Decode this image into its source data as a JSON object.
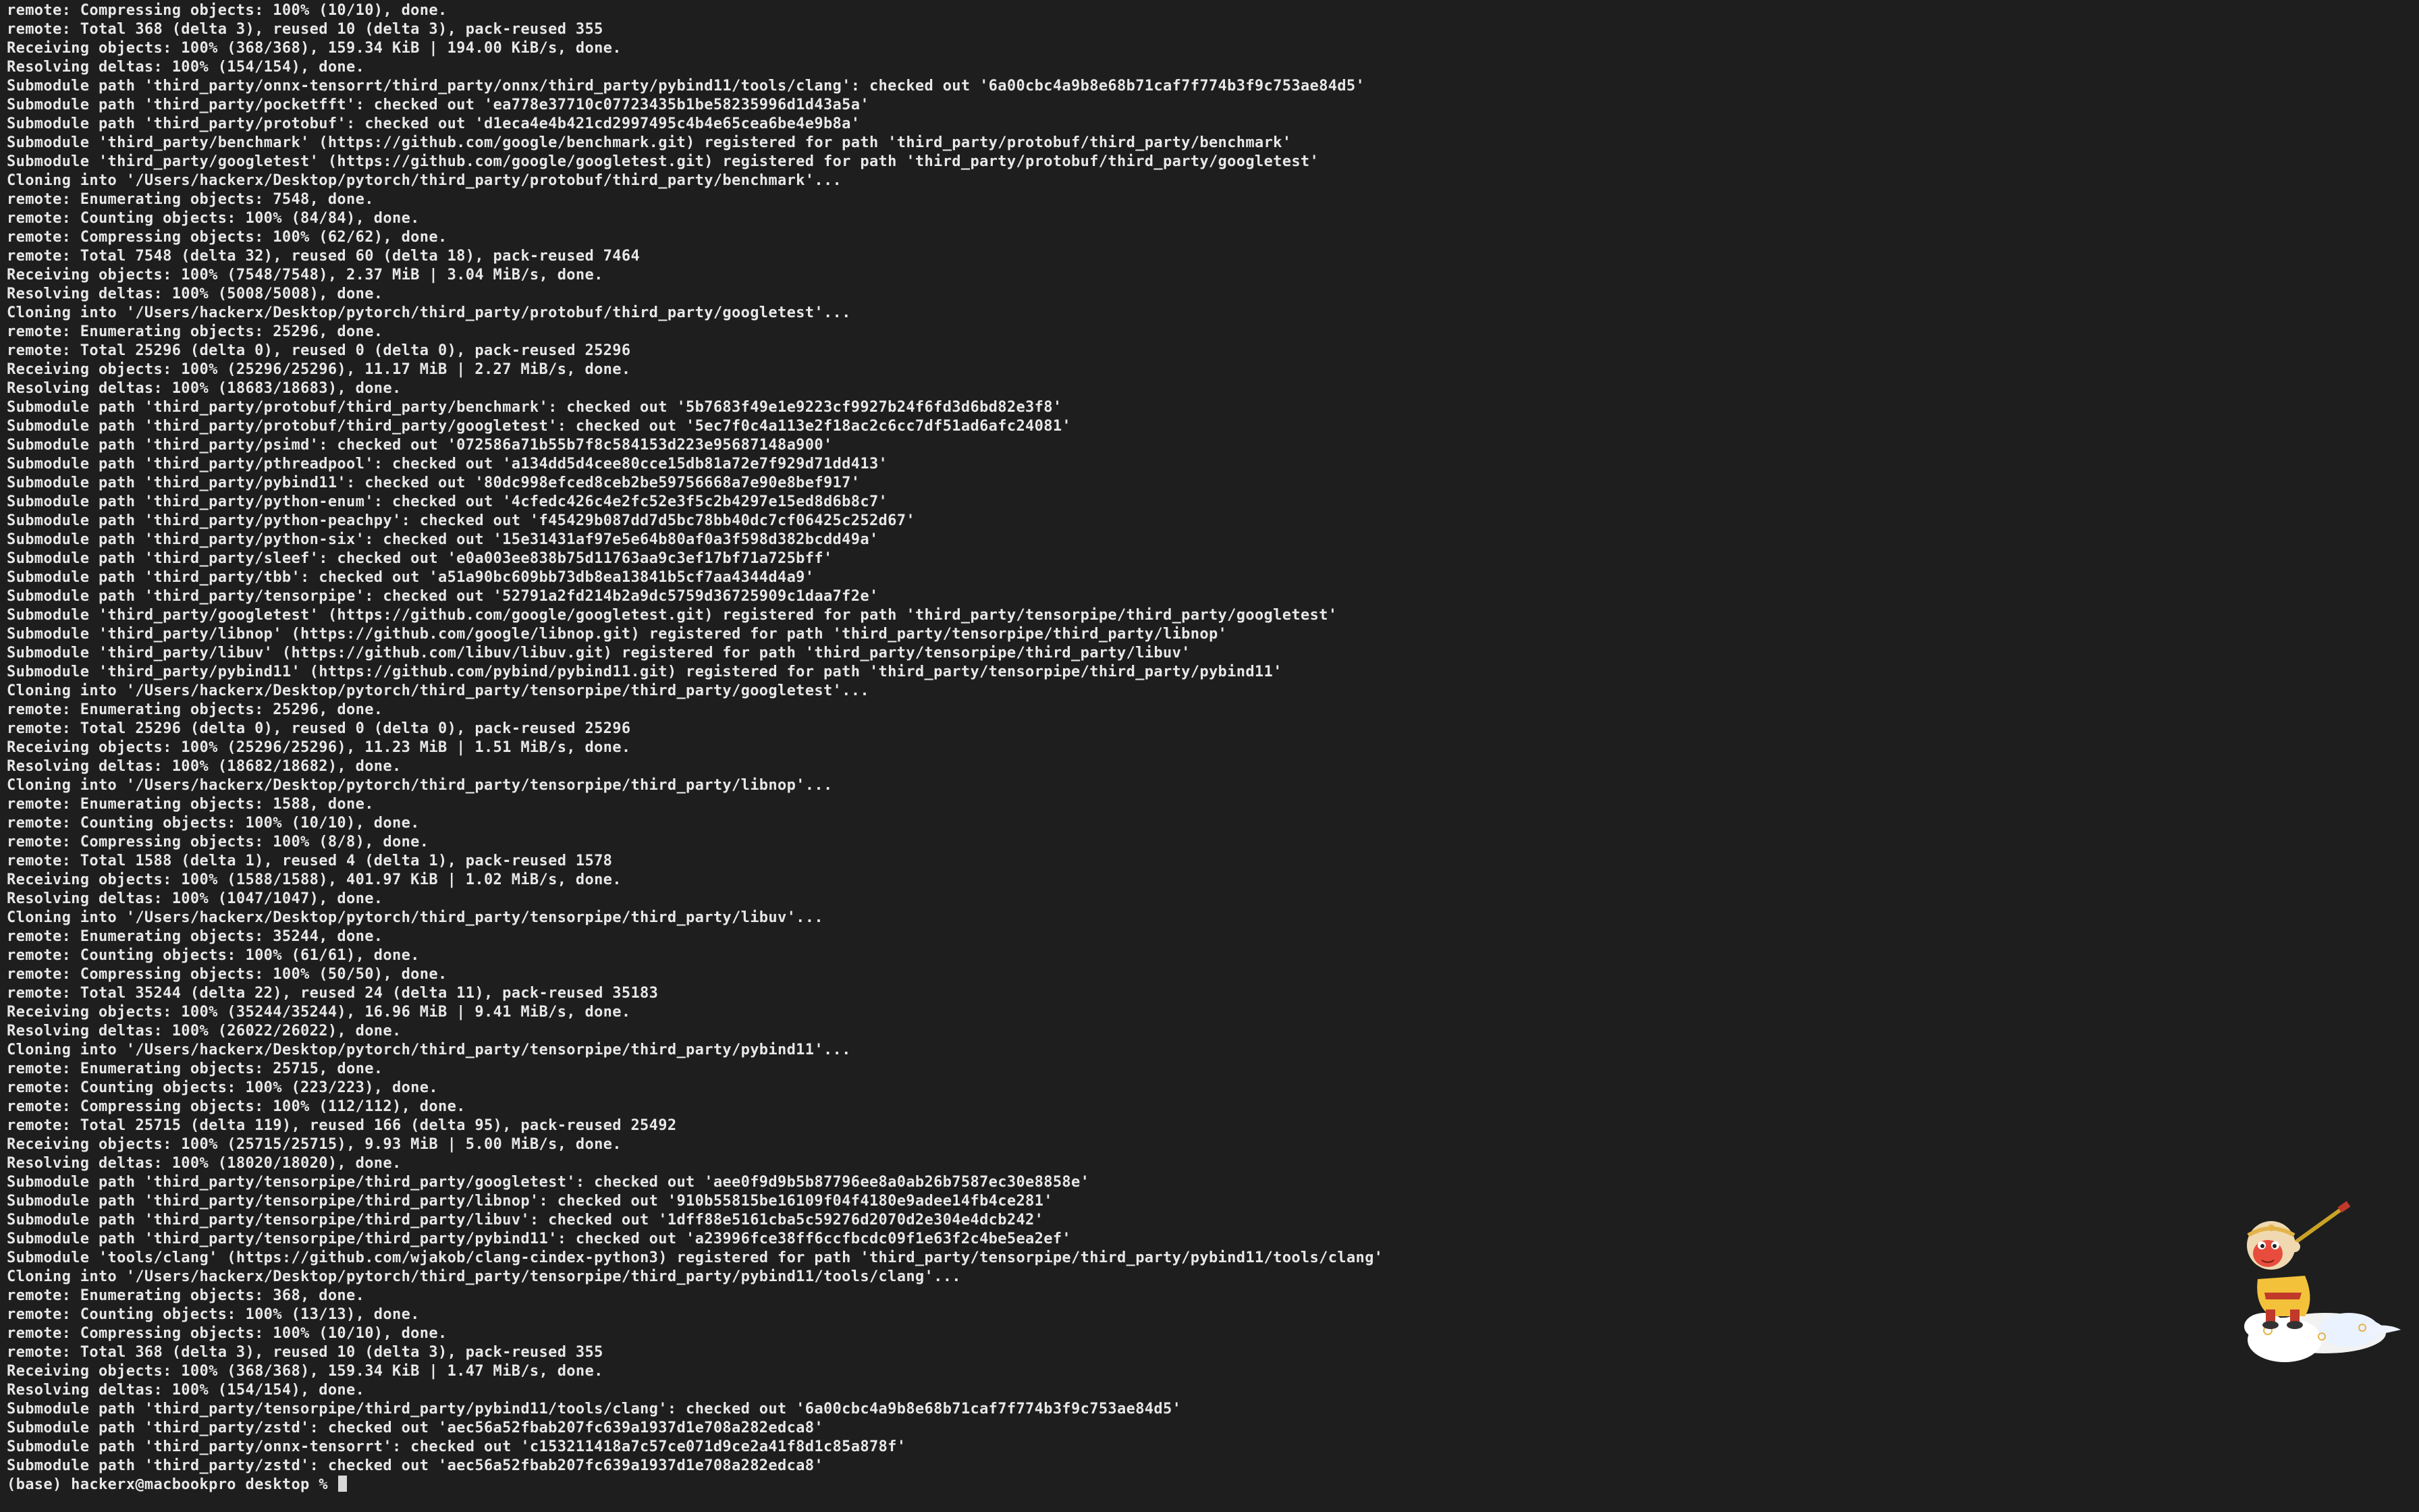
{
  "terminal": {
    "lines": [
      "remote: Compressing objects: 100% (10/10), done.",
      "remote: Total 368 (delta 3), reused 10 (delta 3), pack-reused 355",
      "Receiving objects: 100% (368/368), 159.34 KiB | 194.00 KiB/s, done.",
      "Resolving deltas: 100% (154/154), done.",
      "Submodule path 'third_party/onnx-tensorrt/third_party/onnx/third_party/pybind11/tools/clang': checked out '6a00cbc4a9b8e68b71caf7f774b3f9c753ae84d5'",
      "Submodule path 'third_party/pocketfft': checked out 'ea778e37710c07723435b1be58235996d1d43a5a'",
      "Submodule path 'third_party/protobuf': checked out 'd1eca4e4b421cd2997495c4b4e65cea6be4e9b8a'",
      "Submodule 'third_party/benchmark' (https://github.com/google/benchmark.git) registered for path 'third_party/protobuf/third_party/benchmark'",
      "Submodule 'third_party/googletest' (https://github.com/google/googletest.git) registered for path 'third_party/protobuf/third_party/googletest'",
      "Cloning into '/Users/hackerx/Desktop/pytorch/third_party/protobuf/third_party/benchmark'...",
      "remote: Enumerating objects: 7548, done.",
      "remote: Counting objects: 100% (84/84), done.",
      "remote: Compressing objects: 100% (62/62), done.",
      "remote: Total 7548 (delta 32), reused 60 (delta 18), pack-reused 7464",
      "Receiving objects: 100% (7548/7548), 2.37 MiB | 3.04 MiB/s, done.",
      "Resolving deltas: 100% (5008/5008), done.",
      "Cloning into '/Users/hackerx/Desktop/pytorch/third_party/protobuf/third_party/googletest'...",
      "remote: Enumerating objects: 25296, done.",
      "remote: Total 25296 (delta 0), reused 0 (delta 0), pack-reused 25296",
      "Receiving objects: 100% (25296/25296), 11.17 MiB | 2.27 MiB/s, done.",
      "Resolving deltas: 100% (18683/18683), done.",
      "Submodule path 'third_party/protobuf/third_party/benchmark': checked out '5b7683f49e1e9223cf9927b24f6fd3d6bd82e3f8'",
      "Submodule path 'third_party/protobuf/third_party/googletest': checked out '5ec7f0c4a113e2f18ac2c6cc7df51ad6afc24081'",
      "Submodule path 'third_party/psimd': checked out '072586a71b55b7f8c584153d223e95687148a900'",
      "Submodule path 'third_party/pthreadpool': checked out 'a134dd5d4cee80cce15db81a72e7f929d71dd413'",
      "Submodule path 'third_party/pybind11': checked out '80dc998efced8ceb2be59756668a7e90e8bef917'",
      "Submodule path 'third_party/python-enum': checked out '4cfedc426c4e2fc52e3f5c2b4297e15ed8d6b8c7'",
      "Submodule path 'third_party/python-peachpy': checked out 'f45429b087dd7d5bc78bb40dc7cf06425c252d67'",
      "Submodule path 'third_party/python-six': checked out '15e31431af97e5e64b80af0a3f598d382bcdd49a'",
      "Submodule path 'third_party/sleef': checked out 'e0a003ee838b75d11763aa9c3ef17bf71a725bff'",
      "Submodule path 'third_party/tbb': checked out 'a51a90bc609bb73db8ea13841b5cf7aa4344d4a9'",
      "Submodule path 'third_party/tensorpipe': checked out '52791a2fd214b2a9dc5759d36725909c1daa7f2e'",
      "Submodule 'third_party/googletest' (https://github.com/google/googletest.git) registered for path 'third_party/tensorpipe/third_party/googletest'",
      "Submodule 'third_party/libnop' (https://github.com/google/libnop.git) registered for path 'third_party/tensorpipe/third_party/libnop'",
      "Submodule 'third_party/libuv' (https://github.com/libuv/libuv.git) registered for path 'third_party/tensorpipe/third_party/libuv'",
      "Submodule 'third_party/pybind11' (https://github.com/pybind/pybind11.git) registered for path 'third_party/tensorpipe/third_party/pybind11'",
      "Cloning into '/Users/hackerx/Desktop/pytorch/third_party/tensorpipe/third_party/googletest'...",
      "remote: Enumerating objects: 25296, done.",
      "remote: Total 25296 (delta 0), reused 0 (delta 0), pack-reused 25296",
      "Receiving objects: 100% (25296/25296), 11.23 MiB | 1.51 MiB/s, done.",
      "Resolving deltas: 100% (18682/18682), done.",
      "Cloning into '/Users/hackerx/Desktop/pytorch/third_party/tensorpipe/third_party/libnop'...",
      "remote: Enumerating objects: 1588, done.",
      "remote: Counting objects: 100% (10/10), done.",
      "remote: Compressing objects: 100% (8/8), done.",
      "remote: Total 1588 (delta 1), reused 4 (delta 1), pack-reused 1578",
      "Receiving objects: 100% (1588/1588), 401.97 KiB | 1.02 MiB/s, done.",
      "Resolving deltas: 100% (1047/1047), done.",
      "Cloning into '/Users/hackerx/Desktop/pytorch/third_party/tensorpipe/third_party/libuv'...",
      "remote: Enumerating objects: 35244, done.",
      "remote: Counting objects: 100% (61/61), done.",
      "remote: Compressing objects: 100% (50/50), done.",
      "remote: Total 35244 (delta 22), reused 24 (delta 11), pack-reused 35183",
      "Receiving objects: 100% (35244/35244), 16.96 MiB | 9.41 MiB/s, done.",
      "Resolving deltas: 100% (26022/26022), done.",
      "Cloning into '/Users/hackerx/Desktop/pytorch/third_party/tensorpipe/third_party/pybind11'...",
      "remote: Enumerating objects: 25715, done.",
      "remote: Counting objects: 100% (223/223), done.",
      "remote: Compressing objects: 100% (112/112), done.",
      "remote: Total 25715 (delta 119), reused 166 (delta 95), pack-reused 25492",
      "Receiving objects: 100% (25715/25715), 9.93 MiB | 5.00 MiB/s, done.",
      "Resolving deltas: 100% (18020/18020), done.",
      "Submodule path 'third_party/tensorpipe/third_party/googletest': checked out 'aee0f9d9b5b87796ee8a0ab26b7587ec30e8858e'",
      "Submodule path 'third_party/tensorpipe/third_party/libnop': checked out '910b55815be16109f04f4180e9adee14fb4ce281'",
      "Submodule path 'third_party/tensorpipe/third_party/libuv': checked out '1dff88e5161cba5c59276d2070d2e304e4dcb242'",
      "Submodule path 'third_party/tensorpipe/third_party/pybind11': checked out 'a23996fce38ff6ccfbcdc09f1e63f2c4be5ea2ef'",
      "Submodule 'tools/clang' (https://github.com/wjakob/clang-cindex-python3) registered for path 'third_party/tensorpipe/third_party/pybind11/tools/clang'",
      "Cloning into '/Users/hackerx/Desktop/pytorch/third_party/tensorpipe/third_party/pybind11/tools/clang'...",
      "remote: Enumerating objects: 368, done.",
      "remote: Counting objects: 100% (13/13), done.",
      "remote: Compressing objects: 100% (10/10), done.",
      "remote: Total 368 (delta 3), reused 10 (delta 3), pack-reused 355",
      "Receiving objects: 100% (368/368), 159.34 KiB | 1.47 MiB/s, done.",
      "Resolving deltas: 100% (154/154), done.",
      "Submodule path 'third_party/tensorpipe/third_party/pybind11/tools/clang': checked out '6a00cbc4a9b8e68b71caf7f774b3f9c753ae84d5'",
      "Submodule path 'third_party/zstd': checked out 'aec56a52fbab207fc639a1937d1e708a282edca8'",
      "Submodule path 'third_party/onnx-tensorrt': checked out 'c153211418a7c57ce071d9ce2a41f8d1c85a878f'",
      "Submodule path 'third_party/zstd': checked out 'aec56a52fbab207fc639a1937d1e708a282edca8'"
    ],
    "prompt": "(base) hackerx@macbookpro desktop % "
  },
  "colors": {
    "background": "#1e1e1e",
    "text": "#e8e8e8",
    "cursor": "#d8d8d8"
  },
  "icons": {
    "mascot": "monkey-king-on-cloud-icon"
  }
}
